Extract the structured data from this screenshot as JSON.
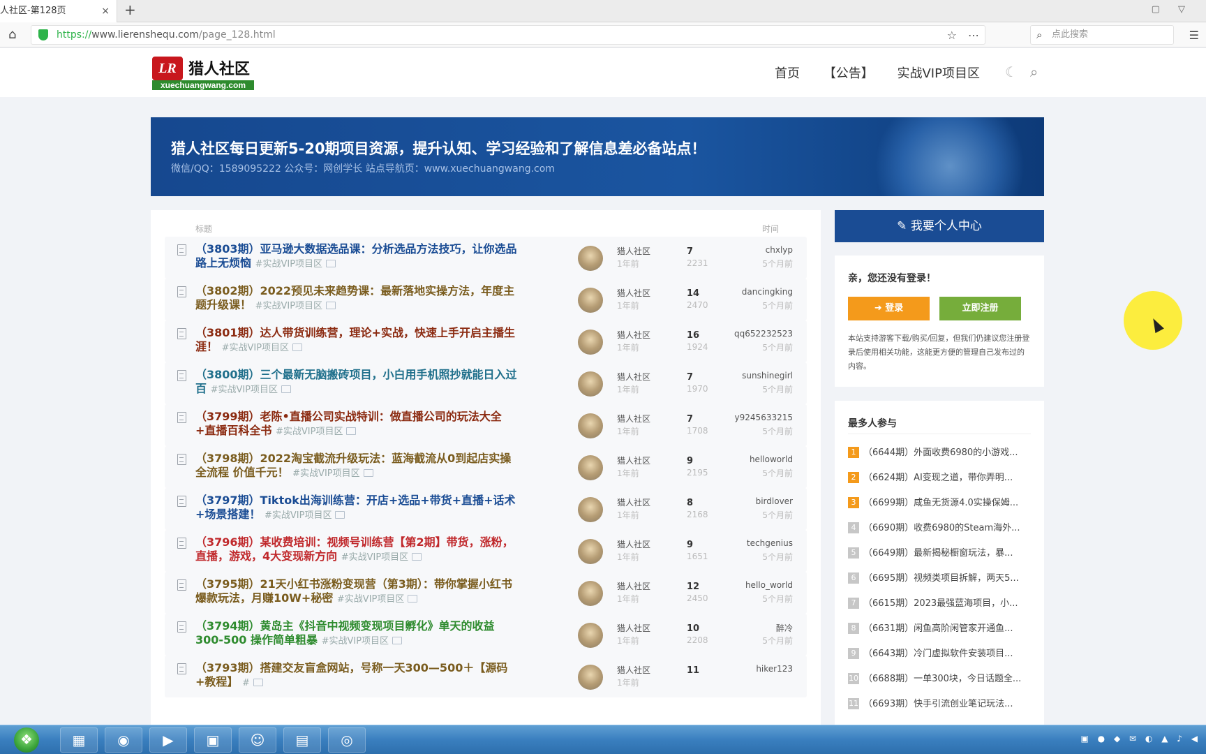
{
  "browser": {
    "tab_title": "人社区-第128页",
    "tab_close": "×",
    "new_tab": "+",
    "url_proto": "https://",
    "url_host": "www.lierenshequ.com",
    "url_path": "/page_128.html",
    "search_placeholder": "点此搜索"
  },
  "site": {
    "logo_badge": "LR",
    "logo_name": "猎人社区",
    "logo_domain": "xuechuangwang.com",
    "nav": [
      "首页",
      "【公告】",
      "实战VIP项目区"
    ]
  },
  "banner": {
    "headline": "猎人社区每日更新5-20期项目资源，提升认知、学习经验和了解信息差必备站点！",
    "sub": "微信/QQ：1589095222 公众号：网创学长 站点导航页：www.xuechuangwang.com"
  },
  "list": {
    "col_title": "标题",
    "col_time": "时间",
    "rows": [
      {
        "title": "（3803期）亚马逊大数据选品课：分析选品方法技巧，让你选品路上无烦恼",
        "tag": "#实战VIP项目区",
        "color": "#1a4c94",
        "author": "猎人社区",
        "ago": "1年前",
        "replies": "7",
        "views": "2231",
        "user": "chxlyp",
        "utime": "5个月前"
      },
      {
        "title": "（3802期）2022预见未来趋势课：最新落地实操方法，年度主题升级课！",
        "tag": "#实战VIP项目区",
        "color": "#7a5c1e",
        "author": "猎人社区",
        "ago": "1年前",
        "replies": "14",
        "views": "2470",
        "user": "dancingking",
        "utime": "5个月前"
      },
      {
        "title": "（3801期）达人带货训练营，理论+实战，快速上手开启主播生涯！",
        "tag": "#实战VIP项目区",
        "color": "#8b2a10",
        "author": "猎人社区",
        "ago": "1年前",
        "replies": "16",
        "views": "1924",
        "user": "qq652232523",
        "utime": "5个月前"
      },
      {
        "title": "（3800期）三个最新无脑搬砖项目，小白用手机照抄就能日入过百",
        "tag": "#实战VIP项目区",
        "color": "#1f6f8b",
        "author": "猎人社区",
        "ago": "1年前",
        "replies": "7",
        "views": "1970",
        "user": "sunshinegirl",
        "utime": "5个月前"
      },
      {
        "title": "（3799期）老陈•直播公司实战特训：做直播公司的玩法大全+直播百科全书",
        "tag": "#实战VIP项目区",
        "color": "#8b2a10",
        "author": "猎人社区",
        "ago": "1年前",
        "replies": "7",
        "views": "1708",
        "user": "y9245633215",
        "utime": "5个月前"
      },
      {
        "title": "（3798期）2022淘宝截流升级玩法：蓝海截流从0到起店实操全流程 价值千元！",
        "tag": "#实战VIP项目区",
        "color": "#7a5c1e",
        "author": "猎人社区",
        "ago": "1年前",
        "replies": "9",
        "views": "2195",
        "user": "helloworld",
        "utime": "5个月前"
      },
      {
        "title": "（3797期）Tiktok出海训练营：开店+选品+带货+直播+话术+场景搭建！",
        "tag": "#实战VIP项目区",
        "color": "#1a4c94",
        "author": "猎人社区",
        "ago": "1年前",
        "replies": "8",
        "views": "2168",
        "user": "birdlover",
        "utime": "5个月前"
      },
      {
        "title": "（3796期）某收费培训：视频号训练营【第2期】带货，涨粉，直播，游戏，4大变现新方向",
        "tag": "#实战VIP项目区",
        "color": "#c0282b",
        "author": "猎人社区",
        "ago": "1年前",
        "replies": "9",
        "views": "1651",
        "user": "techgenius",
        "utime": "5个月前"
      },
      {
        "title": "（3795期）21天小红书涨粉变现营（第3期）：带你掌握小红书爆款玩法，月赚10W+秘密",
        "tag": "#实战VIP项目区",
        "color": "#7a5c1e",
        "author": "猎人社区",
        "ago": "1年前",
        "replies": "12",
        "views": "2450",
        "user": "hello_world",
        "utime": "5个月前"
      },
      {
        "title": "（3794期）黄岛主《抖音中视频变现项目孵化》单天的收益300-500 操作简单粗暴",
        "tag": "#实战VIP项目区",
        "color": "#2e8b2e",
        "author": "猎人社区",
        "ago": "1年前",
        "replies": "10",
        "views": "2208",
        "user": "醉冷",
        "utime": "5个月前"
      },
      {
        "title": "（3793期）搭建交友盲盒网站，号称一天300—500＋【源码+教程】",
        "tag": "#",
        "color": "#7a5c1e",
        "author": "猎人社区",
        "ago": "1年前",
        "replies": "11",
        "views": "",
        "user": "hiker123",
        "utime": ""
      }
    ]
  },
  "sidebar": {
    "user_center": "我要个人中心",
    "greeting": "亲，您还没有登录！",
    "login": "登录",
    "register": "立即注册",
    "note": "本站支持游客下载/购买/回复，但我们仍建议您注册登录后使用相关功能，这能更方便的管理自己发布过的内容。",
    "popular_title": "最多人参与",
    "popular": [
      {
        "num": "1",
        "text": "（6644期）外面收费6980的小游戏...",
        "color": "#f49a1b"
      },
      {
        "num": "2",
        "text": "（6624期）AI变现之道，带你弄明...",
        "color": "#f49a1b"
      },
      {
        "num": "3",
        "text": "（6699期）咸鱼无货源4.0实操保姆...",
        "color": "#f49a1b"
      },
      {
        "num": "4",
        "text": "（6690期）收费6980的Steam海外...",
        "color": "#c7c7c7"
      },
      {
        "num": "5",
        "text": "（6649期）最新揭秘橱窗玩法，暴...",
        "color": "#c7c7c7"
      },
      {
        "num": "6",
        "text": "（6695期）视频类项目拆解，两天5...",
        "color": "#c7c7c7"
      },
      {
        "num": "7",
        "text": "（6615期）2023最强蓝海项目，小...",
        "color": "#c7c7c7"
      },
      {
        "num": "8",
        "text": "（6631期）闲鱼高阶闲管家开通鱼...",
        "color": "#c7c7c7"
      },
      {
        "num": "9",
        "text": "（6643期）冷门虚拟软件安装项目...",
        "color": "#c7c7c7"
      },
      {
        "num": "10",
        "text": "（6688期）一单300块，今日话题全...",
        "color": "#c7c7c7"
      },
      {
        "num": "11",
        "text": "（6693期）快手引流创业笔记玩法...",
        "color": "#c7c7c7"
      }
    ]
  }
}
